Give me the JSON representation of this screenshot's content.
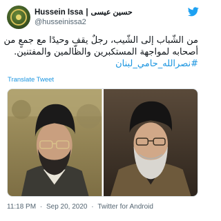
{
  "author": {
    "display_name": "Hussein Issa",
    "separator": "|",
    "arabic_name": "حسين عيسى",
    "handle": "@husseinissa2"
  },
  "tweet": {
    "line1": "من الشّباب إلى الشّيب، رجلٌ يقف وحيدًا مع جمعٍ من",
    "line2": "أصحابه لمواجهة المستكبرين والظّالمين والمفتنين.",
    "hashtag": "#نصرالله_حامي_لبنان",
    "translate_label": "Translate Tweet"
  },
  "meta": {
    "time": "11:18 PM",
    "dot1": "·",
    "date": "Sep 20, 2020",
    "dot2": "·",
    "source": "Twitter for Android"
  },
  "icons": {
    "bird": "twitter-bird-icon"
  },
  "colors": {
    "link": "#1b95e0",
    "text": "#0f1419",
    "muted": "#536471"
  }
}
